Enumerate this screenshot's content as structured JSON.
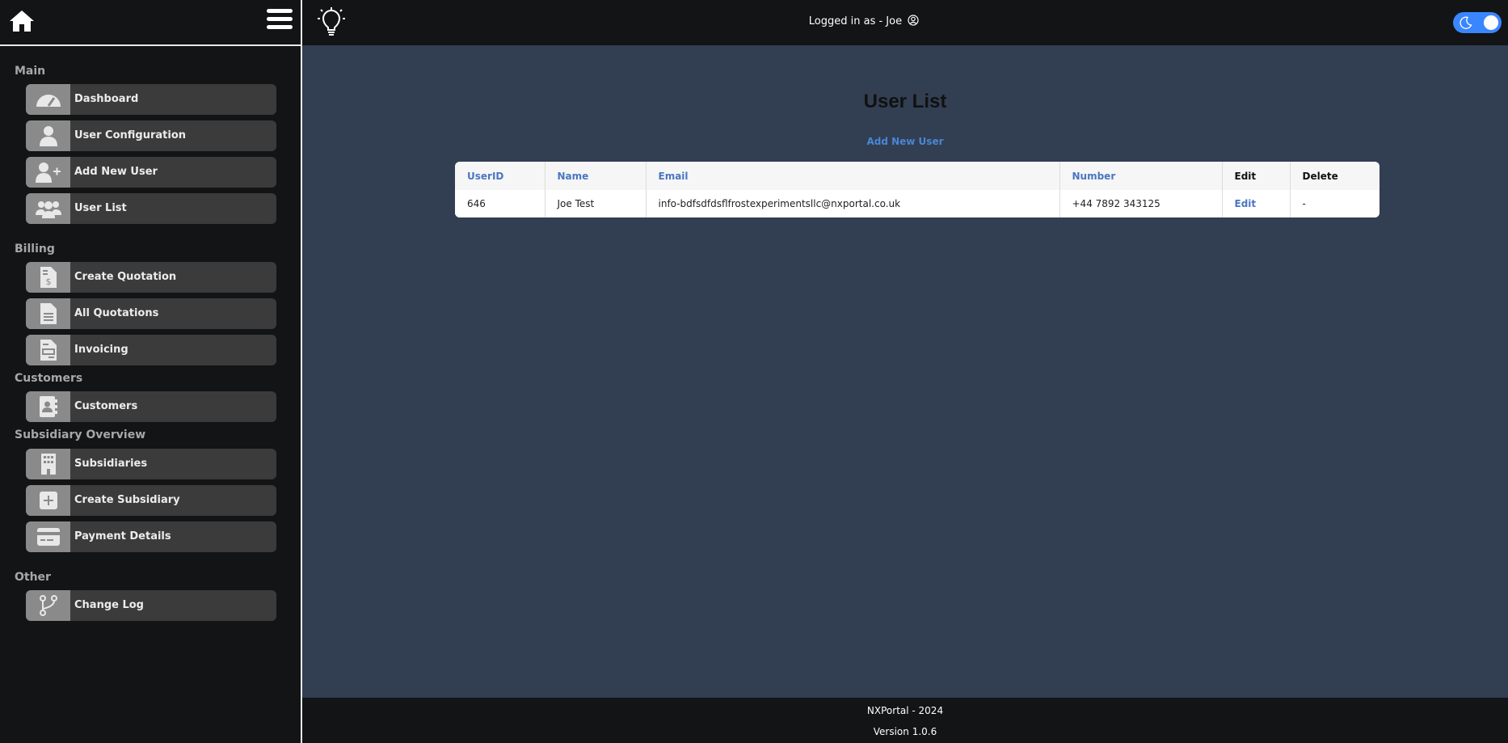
{
  "sidebar": {
    "sections": [
      {
        "title": "Main"
      },
      {
        "title": "Billing"
      },
      {
        "title": "Customers"
      },
      {
        "title": "Subsidiary Overview"
      },
      {
        "title": "Other"
      }
    ],
    "items": [
      {
        "label": "Dashboard",
        "icon": "gauge-icon"
      },
      {
        "label": "User Configuration",
        "icon": "user-icon"
      },
      {
        "label": "Add New User",
        "icon": "user-plus-icon"
      },
      {
        "label": "User List",
        "icon": "users-icon"
      },
      {
        "label": "Create Quotation",
        "icon": "invoice-dollar-icon"
      },
      {
        "label": "All Quotations",
        "icon": "document-icon"
      },
      {
        "label": "Invoicing",
        "icon": "invoice-icon"
      },
      {
        "label": "Customers",
        "icon": "address-book-icon"
      },
      {
        "label": "Subsidiaries",
        "icon": "building-icon"
      },
      {
        "label": "Create Subsidiary",
        "icon": "plus-square-icon"
      },
      {
        "label": "Payment Details",
        "icon": "credit-card-icon"
      },
      {
        "label": "Change Log",
        "icon": "code-branch-icon"
      }
    ]
  },
  "topbar": {
    "login_text": "Logged in as - Joe",
    "theme_toggle": "on"
  },
  "main": {
    "title": "User List",
    "add_link": "Add New User",
    "table": {
      "headers": [
        "UserID",
        "Name",
        "Email",
        "Number",
        "Edit",
        "Delete"
      ],
      "rows": [
        [
          "646",
          "Joe Test",
          "info-bdfsdfdsflfrostexperimentsllc@nxportal.co.uk",
          "+44 7892 343125",
          "Edit",
          "-"
        ]
      ]
    }
  },
  "footer": {
    "line1": "NXPortal - 2024",
    "line2": "Version 1.0.6"
  },
  "colors": {
    "accent": "#3a86ff",
    "link": "#4a76c2",
    "sidebar_bg": "#121416",
    "main_bg": "#323e52"
  }
}
